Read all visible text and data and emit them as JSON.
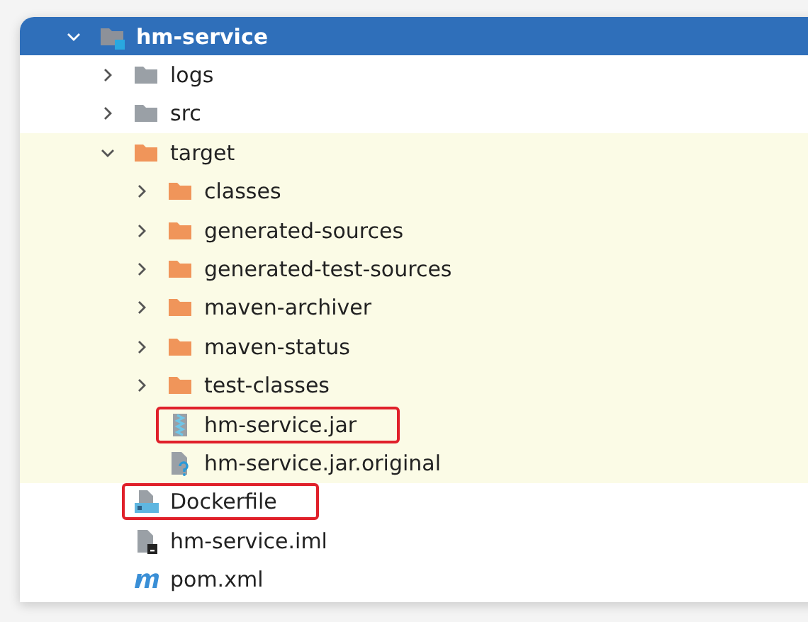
{
  "project_tree": {
    "items": [
      {
        "label": "hm-service",
        "kind": "module",
        "selected": true,
        "expanded": true,
        "excluded": false,
        "highlighted": false,
        "children": [
          {
            "label": "logs",
            "kind": "folder",
            "selected": false,
            "expanded": false,
            "excluded": false,
            "highlighted": false
          },
          {
            "label": "src",
            "kind": "folder",
            "selected": false,
            "expanded": false,
            "excluded": false,
            "highlighted": false
          },
          {
            "label": "target",
            "kind": "excluded-folder",
            "selected": false,
            "expanded": true,
            "excluded": true,
            "highlighted": false,
            "children": [
              {
                "label": "classes",
                "kind": "excluded-folder",
                "selected": false,
                "expanded": false,
                "excluded": true,
                "highlighted": false
              },
              {
                "label": "generated-sources",
                "kind": "excluded-folder",
                "selected": false,
                "expanded": false,
                "excluded": true,
                "highlighted": false
              },
              {
                "label": "generated-test-sources",
                "kind": "excluded-folder",
                "selected": false,
                "expanded": false,
                "excluded": true,
                "highlighted": false
              },
              {
                "label": "maven-archiver",
                "kind": "excluded-folder",
                "selected": false,
                "expanded": false,
                "excluded": true,
                "highlighted": false
              },
              {
                "label": "maven-status",
                "kind": "excluded-folder",
                "selected": false,
                "expanded": false,
                "excluded": true,
                "highlighted": false
              },
              {
                "label": "test-classes",
                "kind": "excluded-folder",
                "selected": false,
                "expanded": false,
                "excluded": true,
                "highlighted": false
              },
              {
                "label": "hm-service.jar",
                "kind": "archive",
                "selected": false,
                "excluded": true,
                "highlighted": true
              },
              {
                "label": "hm-service.jar.original",
                "kind": "unknown",
                "selected": false,
                "excluded": true,
                "highlighted": false
              }
            ]
          },
          {
            "label": "Dockerfile",
            "kind": "dockerfile",
            "selected": false,
            "excluded": false,
            "highlighted": true
          },
          {
            "label": "hm-service.iml",
            "kind": "iml",
            "selected": false,
            "excluded": false,
            "highlighted": false
          },
          {
            "label": "pom.xml",
            "kind": "maven",
            "selected": false,
            "excluded": false,
            "highlighted": false
          }
        ]
      }
    ]
  }
}
